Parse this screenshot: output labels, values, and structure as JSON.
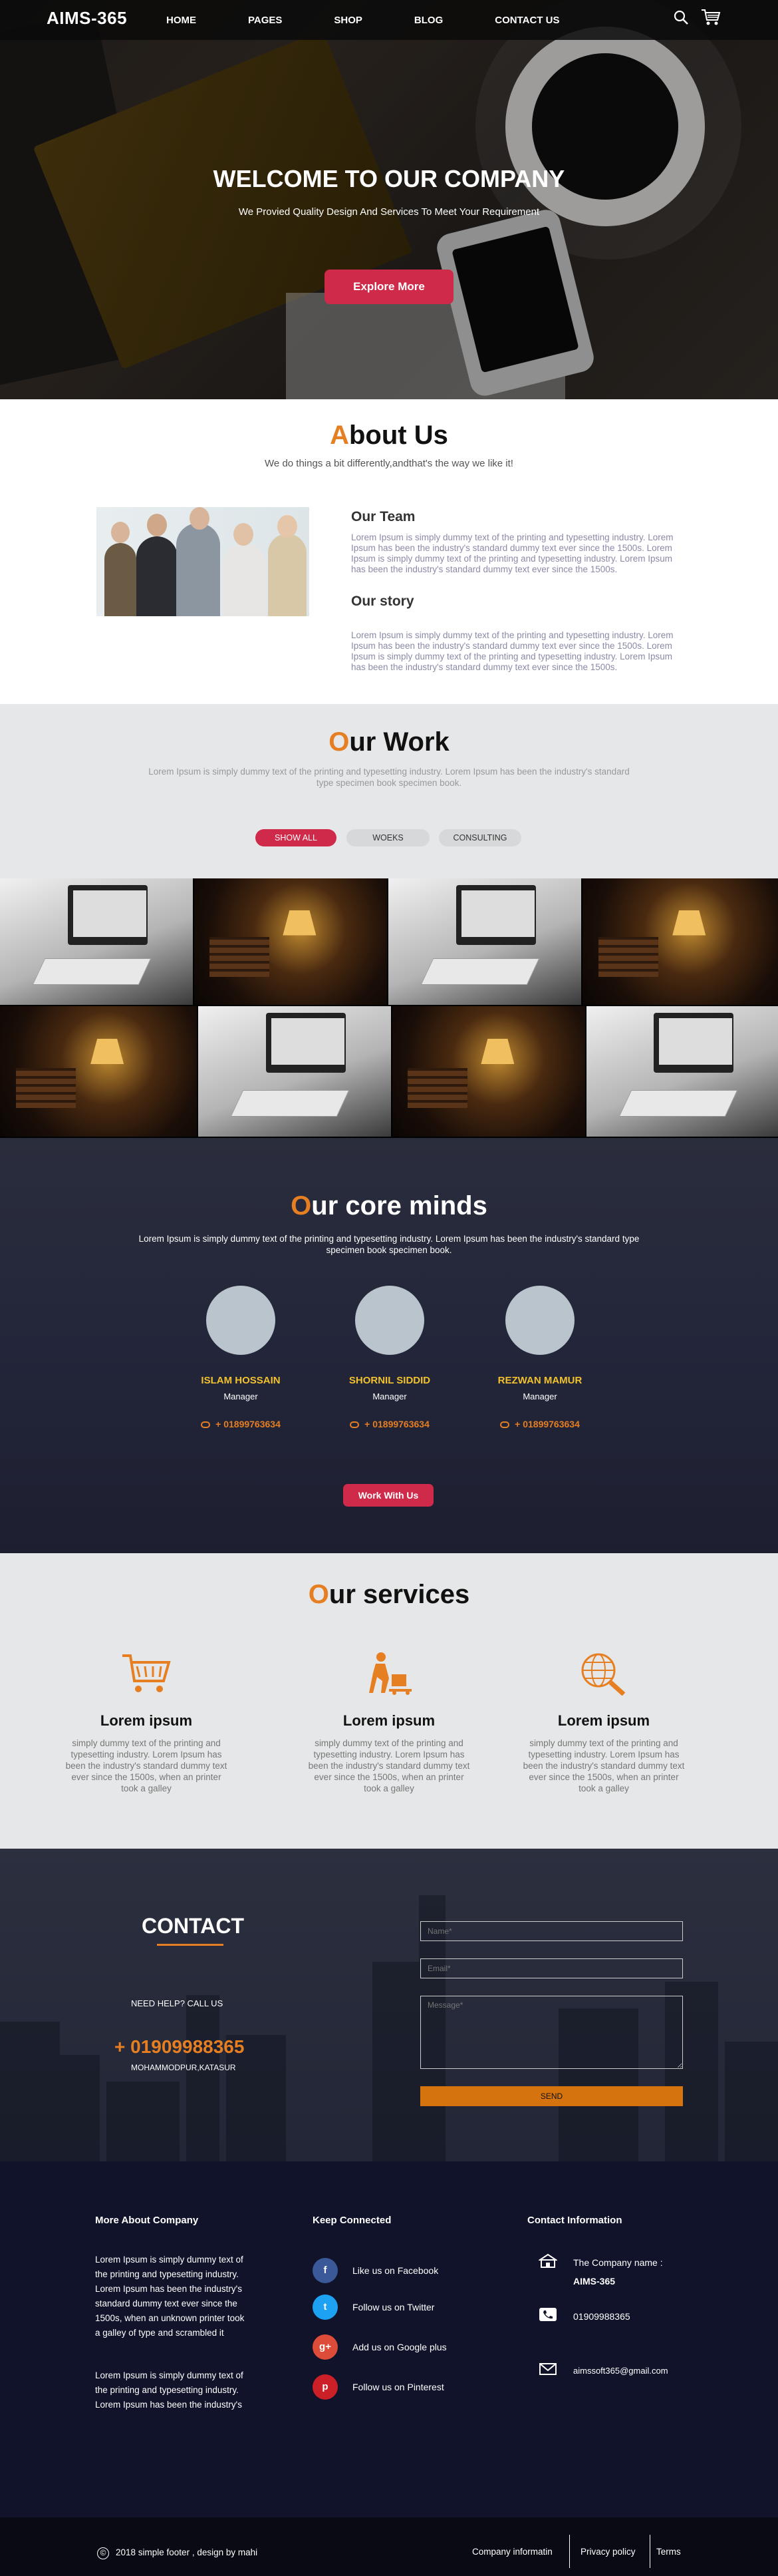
{
  "nav": {
    "logo": "AIMS-365",
    "items": [
      "HOME",
      "PAGES",
      "SHOP",
      "BLOG",
      "CONTACT US"
    ]
  },
  "hero": {
    "title": "WELCOME TO OUR COMPANY",
    "subtitle": "We Provied Quality Design And Services To Meet Your Requirement",
    "button": "Explore More"
  },
  "about": {
    "title_first": "A",
    "title_rest": "bout Us",
    "subtitle": "We do things a bit differently,andthat's the way we like it!",
    "team_heading": "Our Team",
    "team_text": "Lorem Ipsum is simply dummy text of the printing and typesetting industry. Lorem Ipsum has been the industry's standard dummy text ever since the 1500s. Lorem Ipsum is simply dummy text of the printing and typesetting industry. Lorem Ipsum has been the industry's standard dummy text ever since the 1500s.",
    "story_heading": "Our story",
    "story_text": "Lorem Ipsum is simply dummy text of the printing and typesetting industry. Lorem Ipsum has been the industry's standard dummy text ever since the 1500s. Lorem Ipsum is simply dummy text of the printing and typesetting industry. Lorem Ipsum has been the industry's standard dummy text ever since the 1500s."
  },
  "work": {
    "title_first": "O",
    "title_rest": "ur Work",
    "subtitle": "Lorem Ipsum is simply dummy text of the printing and typesetting industry. Lorem Ipsum has been the industry's standard type specimen book specimen book.",
    "filters": [
      "SHOW ALL",
      "WOEKS",
      "CONSULTING"
    ]
  },
  "core": {
    "title_first": "O",
    "title_rest": "ur core minds",
    "subtitle": "Lorem Ipsum is simply dummy text of the printing and typesetting industry. Lorem Ipsum has been the industry's standard type specimen book specimen book.",
    "members": [
      {
        "name": "ISLAM HOSSAIN",
        "role": "Manager",
        "phone": "+ 01899763634"
      },
      {
        "name": "SHORNIL SIDDID",
        "role": "Manager",
        "phone": "+ 01899763634"
      },
      {
        "name": "REZWAN MAMUR",
        "role": "Manager",
        "phone": "+ 01899763634"
      }
    ],
    "button": "Work With Us"
  },
  "services": {
    "title_first": "O",
    "title_rest": "ur services",
    "items": [
      {
        "icon": "cart-icon",
        "title": "Lorem ipsum",
        "text": "simply dummy text of the printing and typesetting industry. Lorem Ipsum has been the industry's standard dummy text ever since the 1500s, when an printer took a galley"
      },
      {
        "icon": "delivery-icon",
        "title": "Lorem ipsum",
        "text": "simply dummy text of the printing and typesetting industry. Lorem Ipsum has been the industry's standard dummy text ever since the 1500s, when an printer took a galley"
      },
      {
        "icon": "globe-search-icon",
        "title": "Lorem ipsum",
        "text": "simply dummy text of the printing and typesetting industry. Lorem Ipsum has been the industry's standard dummy text ever since the 1500s, when an printer took a galley"
      }
    ]
  },
  "contact": {
    "title": "CONTACT",
    "need_help": "NEED HELP? CALL US",
    "phone": "+ 01909988365",
    "address": "MOHAMMODPUR,KATASUR",
    "name_placeholder": "Name*",
    "email_placeholder": "Email*",
    "message_placeholder": "Message*",
    "send": "SEND"
  },
  "footer": {
    "about_heading": "More About Company",
    "about_text_1": "Lorem Ipsum is simply dummy text of the printing and typesetting industry. Lorem Ipsum has been the industry's standard dummy text ever since the 1500s, when an unknown printer took a galley of type and scrambled it",
    "about_text_2": "Lorem Ipsum is simply dummy text of the printing and typesetting industry. Lorem Ipsum has been the industry's",
    "keep_heading": "Keep Connected",
    "social": [
      {
        "icon": "facebook-icon",
        "glyph": "f",
        "color": "#3b5998",
        "label": "Like us on Facebook"
      },
      {
        "icon": "twitter-icon",
        "glyph": "t",
        "color": "#1da1f2",
        "label": "Follow us on Twitter"
      },
      {
        "icon": "google-plus-icon",
        "glyph": "g+",
        "color": "#dd4b39",
        "label": "Add us on Google plus"
      },
      {
        "icon": "pinterest-icon",
        "glyph": "p",
        "color": "#cb2027",
        "label": "Follow us on Pinterest"
      }
    ],
    "contact_heading": "Contact Information",
    "company_label": "The Company name :",
    "company_name": "AIMS-365",
    "phone": "01909988365",
    "email": "aimssoft365@gmail.com"
  },
  "bottom": {
    "copyright": "2018 simple footer , design by mahi",
    "links": [
      "Company informatin",
      "Privacy policy",
      "Terms"
    ]
  },
  "colors": {
    "accent_red": "#cf2a4a",
    "accent_orange": "#e67e22",
    "name_yellow": "#f2c12e",
    "footer_bg": "#11132a"
  }
}
